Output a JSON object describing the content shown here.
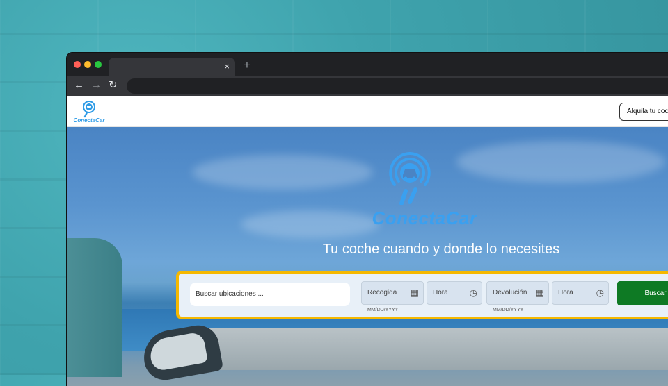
{
  "browser": {
    "tab_close": "×",
    "new_tab": "+",
    "nav": {
      "back": "←",
      "forward": "→",
      "reload": "↻"
    }
  },
  "header": {
    "logo_text": "ConectaCar",
    "rent_button": "Alquila tu coche"
  },
  "hero": {
    "brand": "ConectaCar",
    "tagline": "Tu coche cuando y donde lo necesites"
  },
  "search": {
    "location_placeholder": "Buscar ubicaciones ...",
    "pickup_label": "Recogida",
    "pickup_helper": "MM/DD/YYYY",
    "pickup_time_label": "Hora",
    "return_label": "Devolución",
    "return_helper": "MM/DD/YYYY",
    "return_time_label": "Hora",
    "submit": "Buscar"
  },
  "icons": {
    "calendar": "calendar-icon",
    "clock": "clock-icon",
    "logo": "location-car-pin-icon"
  },
  "colors": {
    "brand_blue": "#2e9be6",
    "search_border": "#f5b800",
    "submit_green": "#0e7a24"
  }
}
